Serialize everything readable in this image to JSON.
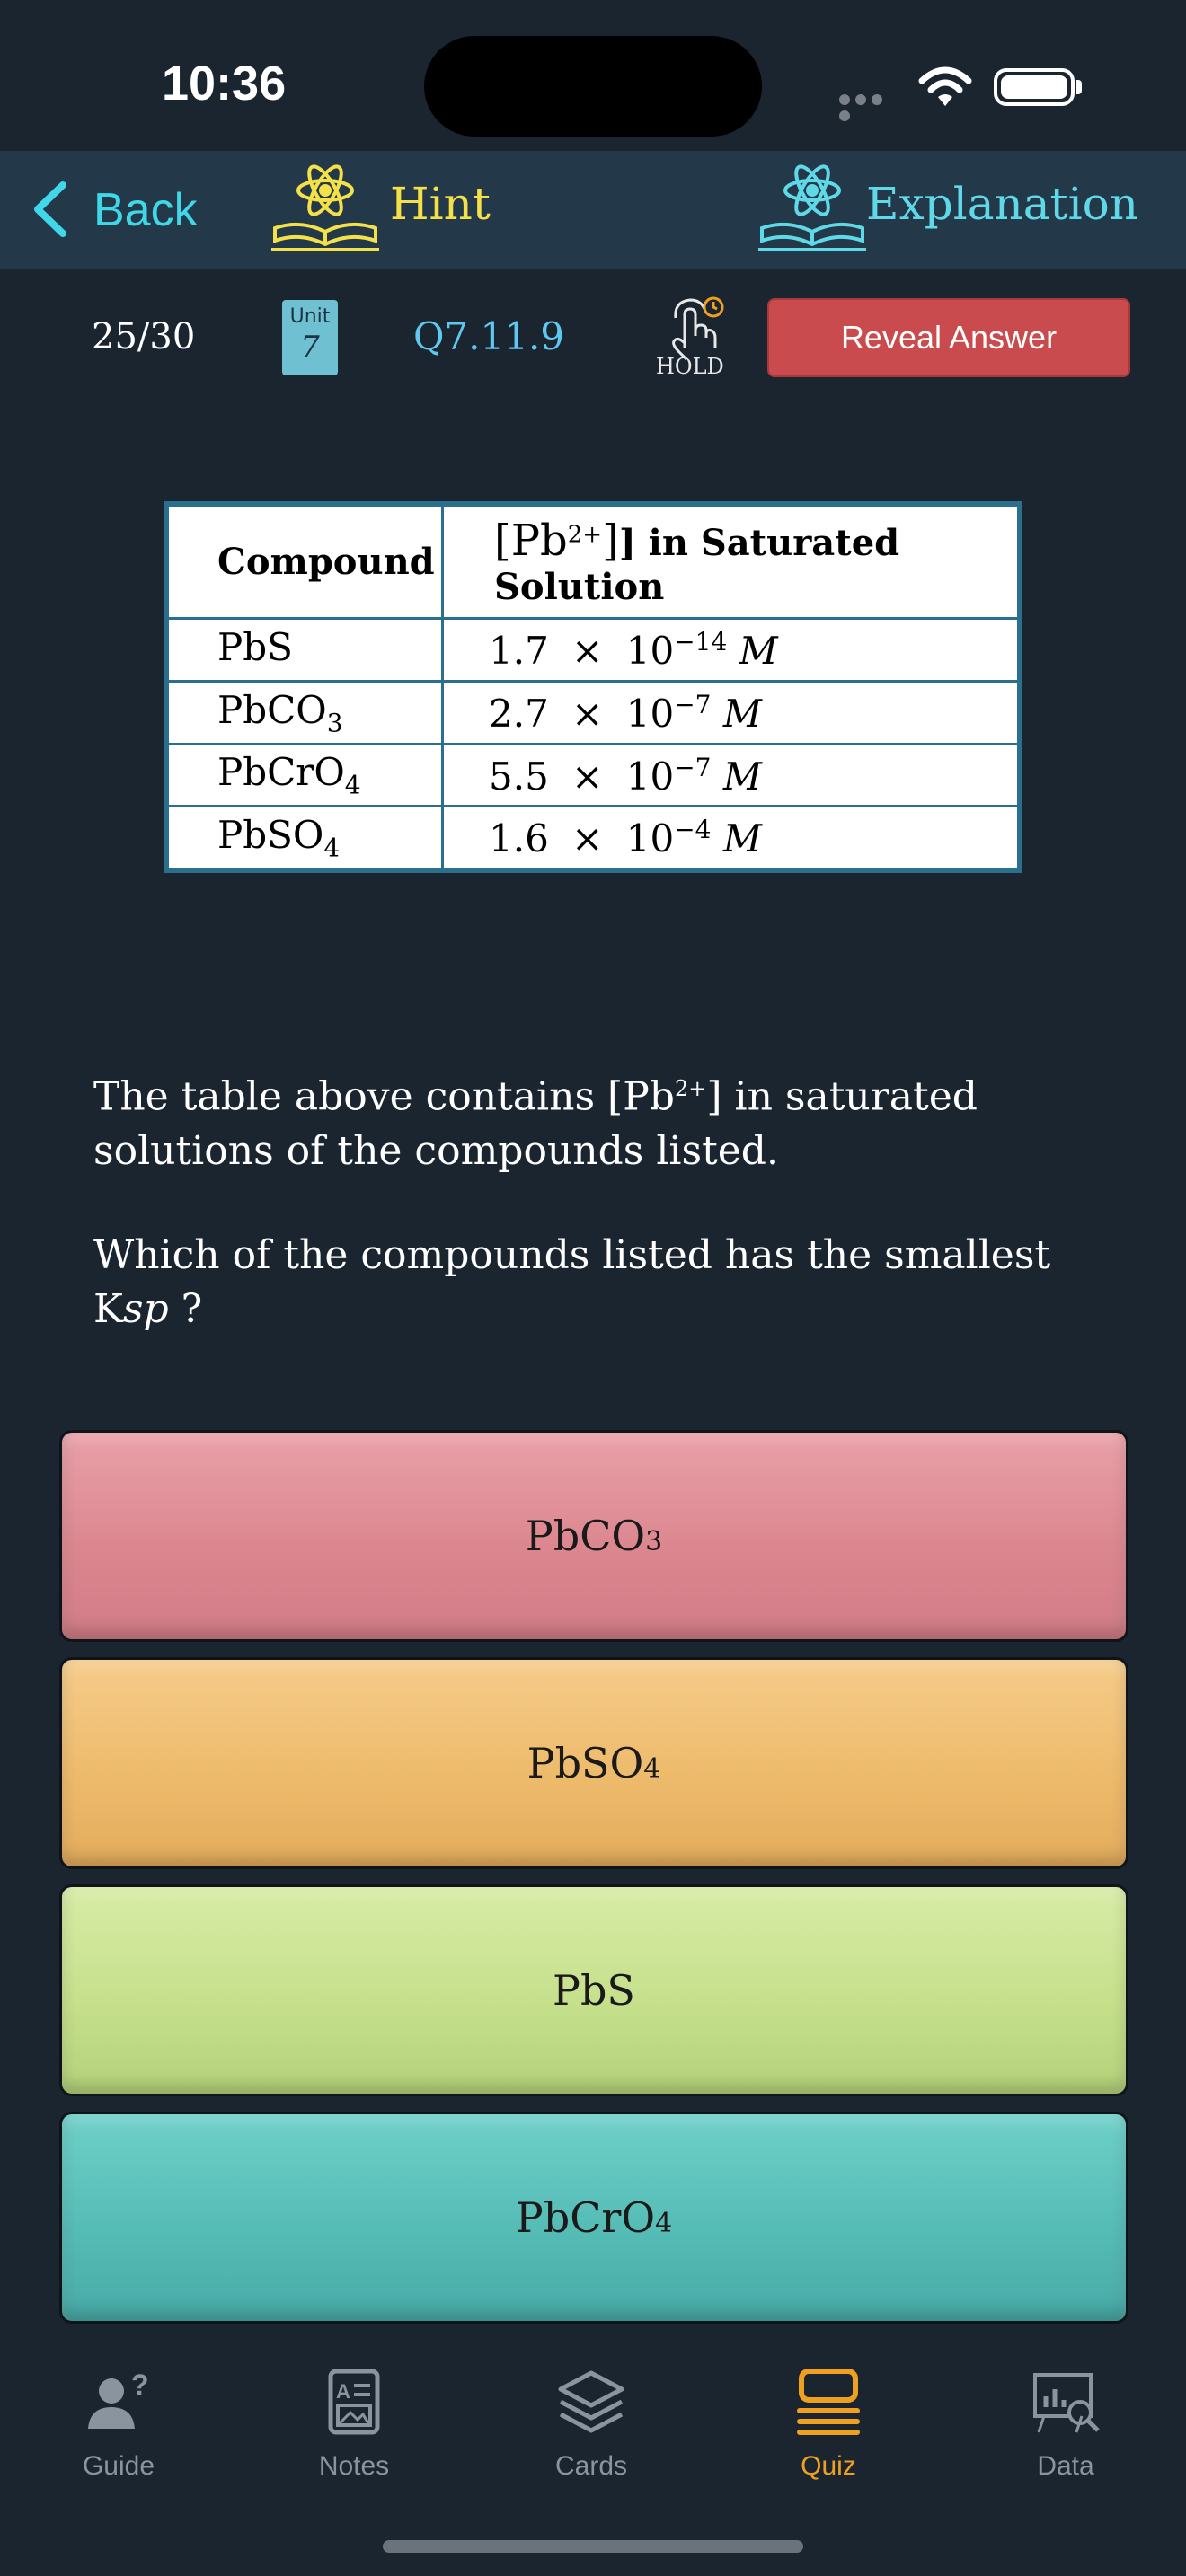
{
  "status_bar": {
    "time": "10:36"
  },
  "nav": {
    "back_label": "Back",
    "hint_label": "Hint",
    "explanation_label": "Explanation"
  },
  "info": {
    "counter": "25/30",
    "unit_word": "Unit",
    "unit_number": "7",
    "question_code": "Q7.11.9",
    "hold_label": "HOLD",
    "reveal_label": "Reveal Answer"
  },
  "table": {
    "header_compound": "Compound",
    "header_conc_pre": "[Pb",
    "header_conc_sup": "2+",
    "header_conc_post": "] in Saturated Solution",
    "rows": [
      {
        "c_main": "PbS",
        "c_sub": "",
        "mant": "1.7",
        "times": "×",
        "base": "10",
        "exp": "−14",
        "unit": "M"
      },
      {
        "c_main": "PbCO",
        "c_sub": "3",
        "mant": "2.7",
        "times": "×",
        "base": "10",
        "exp": "−7",
        "unit": "M"
      },
      {
        "c_main": "PbCrO",
        "c_sub": "4",
        "mant": "5.5",
        "times": "×",
        "base": "10",
        "exp": "−7",
        "unit": "M"
      },
      {
        "c_main": "PbSO",
        "c_sub": "4",
        "mant": "1.6",
        "times": "×",
        "base": "10",
        "exp": "−4",
        "unit": "M"
      }
    ]
  },
  "question": {
    "p1_pre": "The table above contains [Pb",
    "p1_sup": "2+",
    "p1_post": "] in saturated solutions of the compounds listed.",
    "p2_pre": "Which of the compounds listed has the smallest K",
    "p2_sub": "sp",
    "p2_post": " ?"
  },
  "choices": [
    {
      "main": "PbCO",
      "sub": "3",
      "color": "#dc8790"
    },
    {
      "main": "PbSO",
      "sub": "4",
      "color": "#eebb6c"
    },
    {
      "main": "PbS",
      "sub": "",
      "color": "#c6e08c"
    },
    {
      "main": "PbCrO",
      "sub": "4",
      "color": "#56bcb6"
    }
  ],
  "tabs": [
    {
      "label": "Guide",
      "icon": "guide-icon"
    },
    {
      "label": "Notes",
      "icon": "notes-icon"
    },
    {
      "label": "Cards",
      "icon": "cards-icon"
    },
    {
      "label": "Quiz",
      "icon": "quiz-icon",
      "active": true
    },
    {
      "label": "Data",
      "icon": "data-icon"
    }
  ],
  "colors": {
    "background": "#1b2530",
    "navbar": "#233848",
    "back_accent": "#40d8e8",
    "hint_accent": "#f4e048",
    "explanation_accent": "#5fd8e8",
    "reveal_button": "#c94b4d",
    "active_tab": "#f0a020",
    "inactive_tab": "#8a949e"
  }
}
